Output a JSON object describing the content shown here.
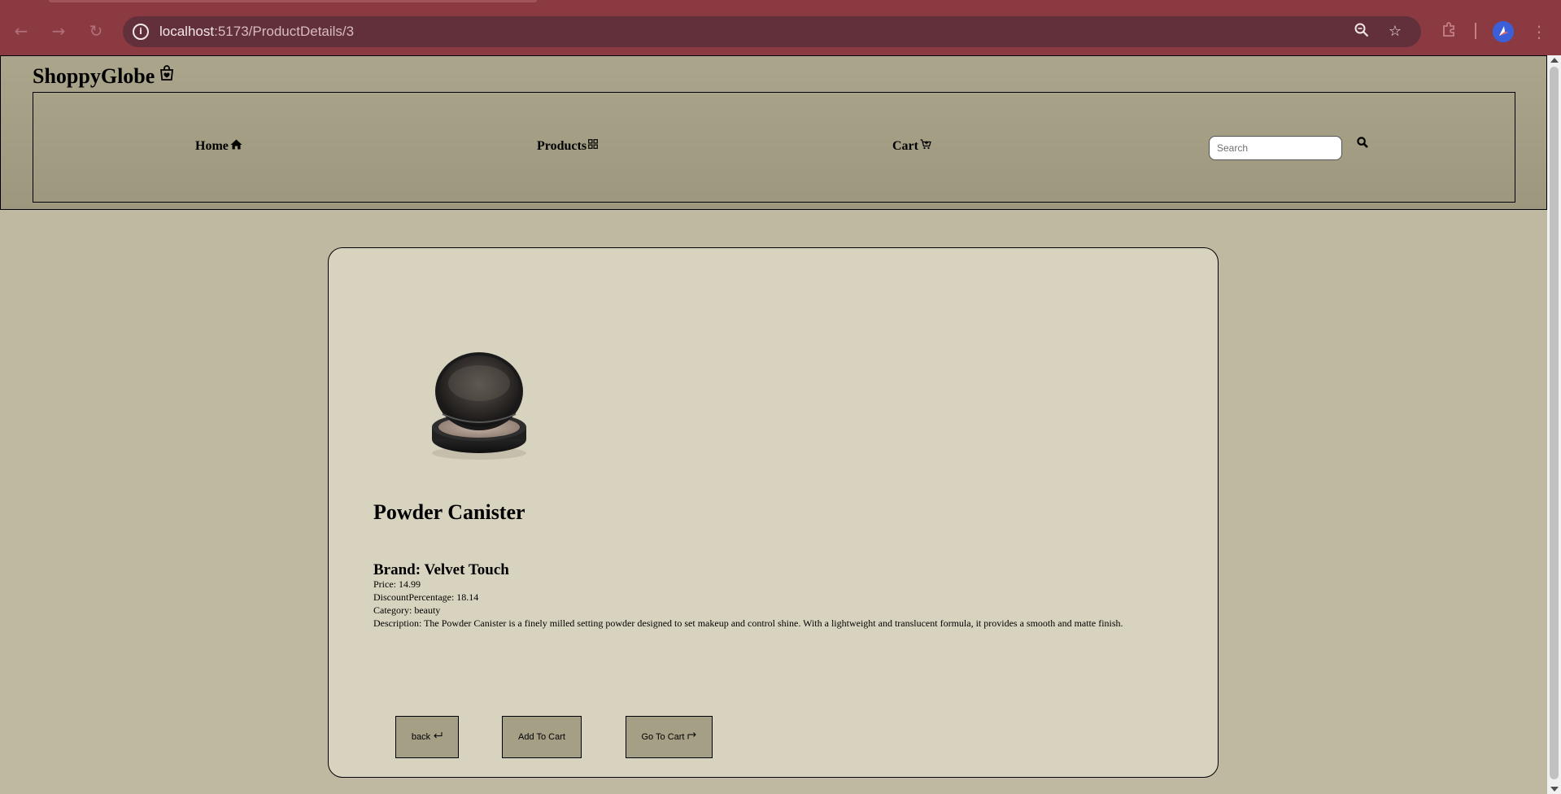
{
  "browser": {
    "url_host": "localhost",
    "url_path": ":5173/ProductDetails/3"
  },
  "header": {
    "brand": "ShoppyGlobe",
    "nav": {
      "home": "Home",
      "products": "Products",
      "cart": "Cart"
    },
    "search": {
      "placeholder": "Search"
    }
  },
  "product": {
    "title": "Powder Canister",
    "brand": "Brand: Velvet Touch",
    "price": "Price: 14.99",
    "discount": "DiscountPercentage: 18.14",
    "category": "Category: beauty",
    "description": "Description: The Powder Canister is a finely milled setting powder designed to set makeup and control shine. With a lightweight and translucent formula, it provides a smooth and matte finish."
  },
  "actions": {
    "back": "back",
    "add_to_cart": "Add To Cart",
    "go_to_cart": "Go To Cart"
  },
  "colors": {
    "chrome": "#8b3a42",
    "page_bg": "#c0b9a1",
    "header_bg": "#a39d84",
    "card_bg": "#d8d3bf",
    "button_bg": "#a59f86"
  }
}
